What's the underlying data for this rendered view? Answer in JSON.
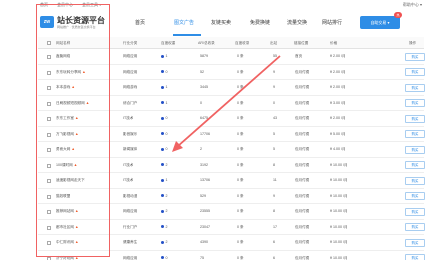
{
  "topbar": {
    "links": [
      "首页",
      "会员中心",
      "会员工具 ▾"
    ],
    "help": "帮助中心 ▾"
  },
  "header": {
    "logo_mark": "zw",
    "logo_title": "站长资源平台",
    "logo_subtitle": "网站推广 · 优质友链交换平台",
    "nav": [
      "首页",
      "图文广告",
      "友链买卖",
      "免费换链",
      "流量交换",
      "网站排行"
    ],
    "active_nav": "友链买卖",
    "cta_label": "自助交易 ▾",
    "cta_badge": "热"
  },
  "table": {
    "headers": [
      "网站名称",
      "行业分类",
      "百度权重",
      "AR/总收录",
      "百度收录",
      "出站",
      "链接位置",
      "价格",
      "操作"
    ],
    "rows": [
      {
        "name": "鑫聚网络",
        "fire": false,
        "category": "网络应用",
        "br": "1",
        "site": "5879",
        "indexed": "0 条",
        "out": "55",
        "position": "首页",
        "price": "¥ 2.00 /月",
        "action": "购买"
      },
      {
        "name": "东东玩转分享网",
        "fire": true,
        "category": "网络应用",
        "br": "0",
        "site": "52",
        "indexed": "0 条",
        "out": "9",
        "position": "包月付费",
        "price": "¥ 2.00 /月",
        "action": "购买"
      },
      {
        "name": "本本游戏",
        "fire": true,
        "category": "网络游戏",
        "br": "1",
        "site": "3445",
        "indexed": "0 条",
        "out": "9",
        "position": "包月付费",
        "price": "¥ 2.00 /月",
        "action": "购买"
      },
      {
        "name": "日刷视频短视频网",
        "fire": true,
        "category": "综合门户",
        "br": "1",
        "site": "0",
        "indexed": "0 条",
        "out": "0",
        "position": "包月付费",
        "price": "¥ 3.00 /月",
        "action": "购买"
      },
      {
        "name": "东东工作室",
        "fire": true,
        "category": "IT技术",
        "br": "0",
        "site": "6475",
        "indexed": "0 条",
        "out": "43",
        "position": "包月付费",
        "price": "¥ 2.00 /月",
        "action": "购买"
      },
      {
        "name": "万飞影视网",
        "fire": true,
        "category": "影音娱乐",
        "br": "0",
        "site": "17706",
        "indexed": "0 条",
        "out": "5",
        "position": "包月付费",
        "price": "¥ 5.00 /月",
        "action": "购买"
      },
      {
        "name": "勇而大网",
        "fire": true,
        "category": "新闻媒体",
        "br": "0",
        "site": "2",
        "indexed": "0 条",
        "out": "5",
        "position": "包月付费",
        "price": "¥ 4.00 /月",
        "action": "购买"
      },
      {
        "name": "100课时网",
        "fire": true,
        "category": "IT技术",
        "br": "2",
        "site": "3192",
        "indexed": "0 条",
        "out": "8",
        "position": "包月付费",
        "price": "¥ 10.00 /月",
        "action": "购买"
      },
      {
        "name": "逍遥影视网走天下",
        "fire": false,
        "category": "IT技术",
        "br": "1",
        "site": "13706",
        "indexed": "0 条",
        "out": "11",
        "position": "包月付费",
        "price": "¥ 10.00 /月",
        "action": "购买"
      },
      {
        "name": "猫奴联盟",
        "fire": false,
        "category": "影视动漫",
        "br": "2",
        "site": "529",
        "indexed": "0 条",
        "out": "9",
        "position": "包月付费",
        "price": "¥ 10.00 /月",
        "action": "购买"
      },
      {
        "name": "推荐网站网",
        "fire": true,
        "category": "网络应用",
        "br": "2",
        "site": "23555",
        "indexed": "0 条",
        "out": "8",
        "position": "包月付费",
        "price": "¥ 10.00 /月",
        "action": "购买"
      },
      {
        "name": "都市社区网",
        "fire": true,
        "category": "行业门户",
        "br": "2",
        "site": "23047",
        "indexed": "0 条",
        "out": "17",
        "position": "包月付费",
        "price": "¥ 10.00 /月",
        "action": "购买"
      },
      {
        "name": "中仁财讯网",
        "fire": true,
        "category": "健康养生",
        "br": "2",
        "site": "4390",
        "indexed": "0 条",
        "out": "6",
        "position": "包月付费",
        "price": "¥ 10.00 /月",
        "action": "购买"
      },
      {
        "name": "济宁好玩网",
        "fire": true,
        "category": "网络应用",
        "br": "0",
        "site": "75",
        "indexed": "0 条",
        "out": "6",
        "position": "包月付费",
        "price": "¥ 10.00 /月",
        "action": "购买"
      }
    ]
  },
  "colors": {
    "accent": "#2e8de6",
    "highlight_box": "#f06262",
    "fire": "#f05a28",
    "weight_dot": "#2451c7"
  }
}
